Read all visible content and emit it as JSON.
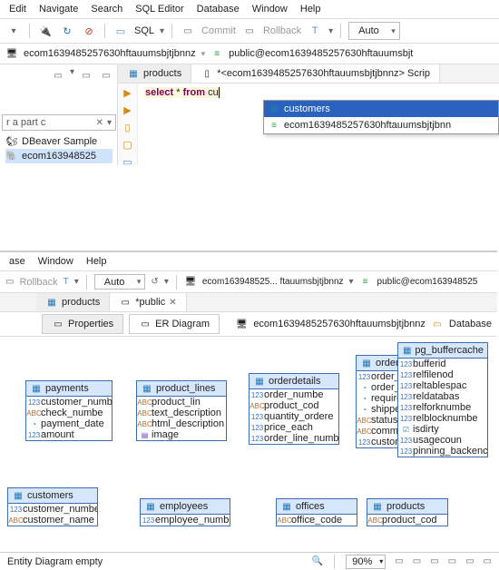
{
  "menus": [
    "Edit",
    "Navigate",
    "Search",
    "SQL Editor",
    "Database",
    "Window",
    "Help"
  ],
  "toolbar": {
    "sql_label": "SQL",
    "commit_label": "Commit",
    "rollback_label": "Rollback",
    "auto_label": "Auto"
  },
  "breadcrumb": {
    "db": "ecom1639485257630hftauumsbjtjbnnz",
    "conn": "public@ecom1639485257630hftauumsbjt"
  },
  "tabs": {
    "products": "products",
    "script": "*<ecom1639485257630hftauumsbjtjbnnz> Scrip"
  },
  "sql": {
    "select": "select",
    "star": "*",
    "from": "from",
    "frag": "cu"
  },
  "autocomplete": {
    "opt0": "customers",
    "opt1": "ecom1639485257630hftauumsbjtjbnn"
  },
  "nav": {
    "filter": "r a part c",
    "node0": "DBeaver Sample",
    "node1": "ecom163948525"
  },
  "panel2": {
    "menus": [
      "ase",
      "Window",
      "Help"
    ],
    "rollback": "Rollback",
    "auto": "Auto",
    "db": "ecom163948525... ftauumsbjtjbnnz",
    "conn": "public@ecom163948525",
    "tab_products": "products",
    "tab_public": "*public",
    "sub_props": "Properties",
    "sub_er": "ER Diagram",
    "foot_db": "ecom1639485257630hftauumsbjtjbnnz",
    "foot_dbs": "Database"
  },
  "er": {
    "payments": {
      "t": "payments",
      "c": [
        "customer_numbe",
        "check_numbe",
        "payment_date",
        "amount"
      ],
      "ty": [
        "n",
        "s",
        "d",
        "n"
      ]
    },
    "product_lines": {
      "t": "product_lines",
      "c": [
        "product_lin",
        "text_description",
        "html_description",
        "image"
      ],
      "ty": [
        "s",
        "s",
        "s",
        "b"
      ]
    },
    "orderdetails": {
      "t": "orderdetails",
      "c": [
        "order_numbe",
        "product_cod",
        "quantity_ordere",
        "price_each",
        "order_line_numbe"
      ],
      "ty": [
        "n",
        "s",
        "n",
        "n",
        "n"
      ]
    },
    "orders": {
      "t": "orders",
      "c": [
        "order_numbe",
        "order_dat",
        "required_dat",
        "shipped_dat",
        "status",
        "comments",
        "customer_numbe"
      ],
      "ty": [
        "n",
        "d",
        "d",
        "d",
        "s",
        "s",
        "n"
      ]
    },
    "pg_buffercache": {
      "t": "pg_buffercache",
      "c": [
        "bufferid",
        "relfilenod",
        "reltablespac",
        "reldatabas",
        "relforknumbe",
        "relblocknumbe",
        "isdirty",
        "usagecoun",
        "pinning_backenc"
      ],
      "ty": [
        "n",
        "n",
        "n",
        "n",
        "n",
        "n",
        "c",
        "n",
        "n"
      ]
    },
    "customers": {
      "t": "customers",
      "c": [
        "customer_numbe",
        "customer_name"
      ],
      "ty": [
        "n",
        "s"
      ]
    },
    "employees": {
      "t": "employees",
      "c": [
        "employee_numbe"
      ],
      "ty": [
        "n"
      ]
    },
    "offices": {
      "t": "offices",
      "c": [
        "office_code"
      ],
      "ty": [
        "s"
      ]
    },
    "products": {
      "t": "products",
      "c": [
        "product_cod"
      ],
      "ty": [
        "s"
      ]
    }
  },
  "status": {
    "label": "Entity Diagram  empty",
    "zoom": "90%"
  }
}
